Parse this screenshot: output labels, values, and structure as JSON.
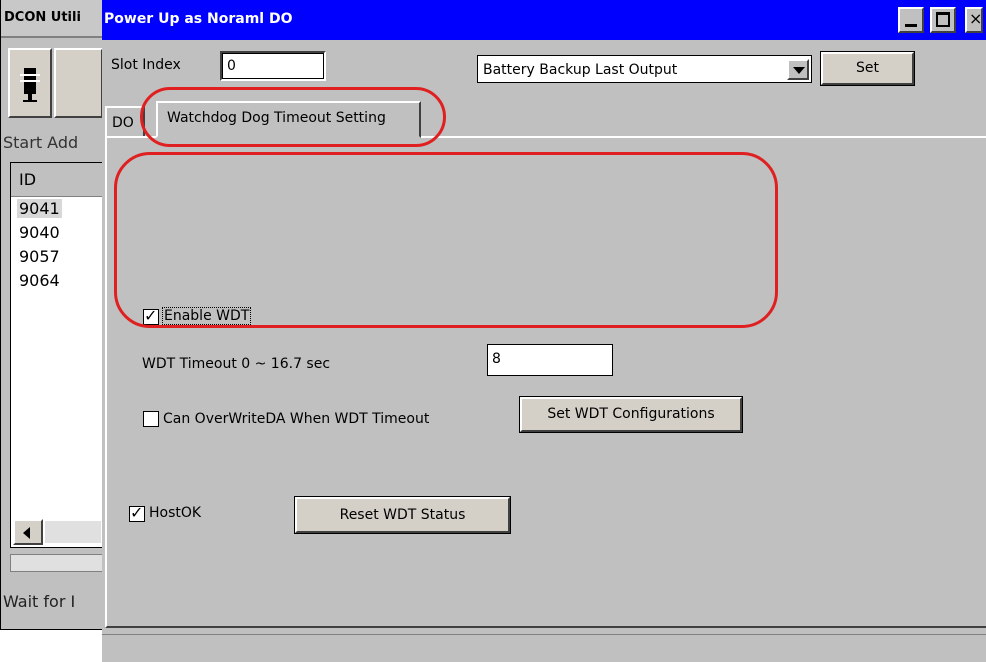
{
  "background_window": {
    "title": "DCON Utili",
    "start_address_label": "Start Add",
    "list_header": "ID",
    "list_items": [
      "9041",
      "9040",
      "9057",
      "9064"
    ],
    "status_text": "Wait for I"
  },
  "dialog": {
    "title": "Power Up as Noraml DO",
    "close_glyph": "×",
    "slot_index_label": "Slot Index",
    "slot_index_value": "0",
    "mode_select_value": "Battery Backup Last Output",
    "set_button": "Set",
    "tabs": [
      {
        "label": "DO",
        "active": false
      },
      {
        "label": "Watchdog Dog Timeout Setting",
        "active": true
      }
    ],
    "wdt": {
      "enable_label": "Enable WDT",
      "enable_checked": true,
      "timeout_label": "WDT Timeout  0 ~ 16.7 sec",
      "timeout_value": "8",
      "overwrite_label": "Can OverWriteDA When  WDT Timeout",
      "overwrite_checked": false,
      "set_config_button": "Set WDT Configurations"
    },
    "host_ok_label": "HostOK",
    "host_ok_checked": true,
    "reset_button": "Reset WDT Status"
  },
  "colors": {
    "titlebar": "#0000ff",
    "dialog_bg": "#c0c0c0",
    "highlight": "#e02020"
  }
}
